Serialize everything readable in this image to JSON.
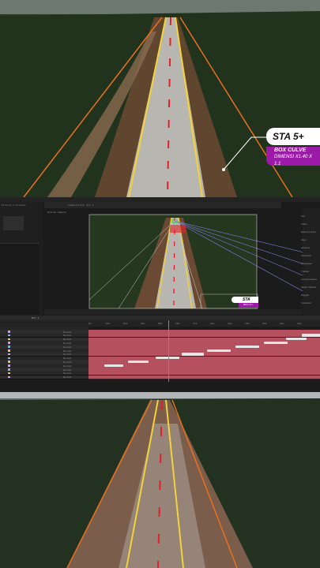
{
  "top_overlay": {
    "station_label": "STA 5+",
    "box_title": "BOX CULVE",
    "box_sub": "DIMENSI X1.40 X 1.1"
  },
  "ae": {
    "comp_tab": "Composition: Ecu 1",
    "panel_label": "Active Camera",
    "overlay_label": "STA",
    "overlay_sub": "BOX CU",
    "project_label": "Effects & Presets",
    "right_panel_items": [
      "Info",
      "Audio",
      "Effects & Pres",
      "Align",
      "Libraries",
      "Character",
      "Paragraph",
      "Tracker",
      "Content-Aware",
      "Motion Sketch",
      "Wiggler",
      "Smoother"
    ],
    "timeline_tab": "Ecu 1",
    "ruler_labels": [
      "0s",
      "02s",
      "04s",
      "06s",
      "08s",
      "10s",
      "12s",
      "14s",
      "16s",
      "18s",
      "20s",
      "22s",
      "24s"
    ],
    "layer_mode": "Normal",
    "row_count": 13
  },
  "colors": {
    "road_line_yellow": "#f2d33a",
    "road_line_orange": "#e8701f",
    "road_center_red": "#e3202a",
    "label_purple": "#9b1aa8",
    "track_red": "#b5505f"
  }
}
